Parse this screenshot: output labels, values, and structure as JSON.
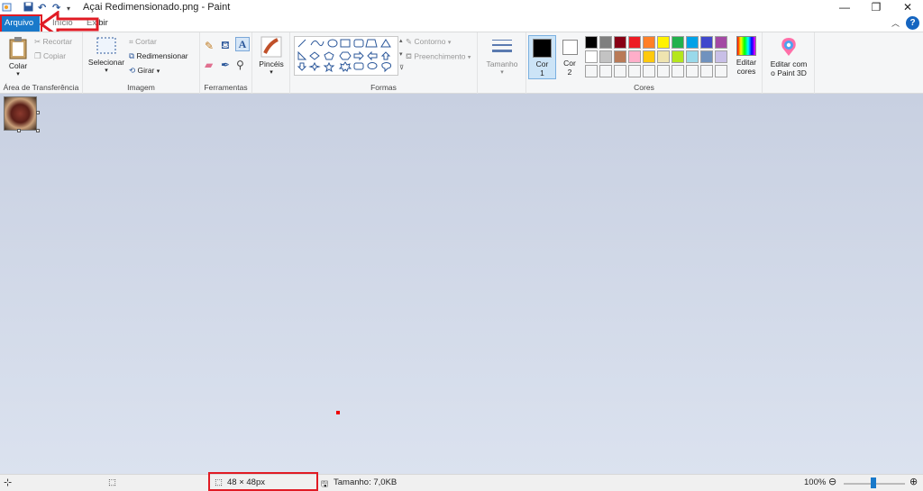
{
  "window": {
    "title": "Açai Redimensionado.png - Paint",
    "minimize": "—",
    "restore": "❐",
    "close": "✕"
  },
  "tabs": {
    "file": "Arquivo",
    "home": "Início",
    "view": "Exibir",
    "help": "?"
  },
  "clipboard": {
    "paste": "Colar",
    "cut": "Recortar",
    "copy": "Copiar",
    "label": "Área de Transferência"
  },
  "image": {
    "select": "Selecionar",
    "crop": "Cortar",
    "resize": "Redimensionar",
    "rotate": "Girar",
    "label": "Imagem"
  },
  "tools": {
    "label": "Ferramentas",
    "text_tool": "A"
  },
  "brushes": {
    "label": "Pincéis"
  },
  "shapes": {
    "outline": "Contorno",
    "fill": "Preenchimento",
    "label": "Formas"
  },
  "size": {
    "label": "Tamanho"
  },
  "colors": {
    "color1": "Cor",
    "color1_num": "1",
    "color2": "Cor",
    "color2_num": "2",
    "edit": "Editar",
    "edit2": "cores",
    "label": "Cores",
    "palette_row1": [
      "#000000",
      "#7f7f7f",
      "#880015",
      "#ed1c24",
      "#ff7f27",
      "#fff200",
      "#22b14c",
      "#00a2e8",
      "#3f48cc",
      "#a349a4"
    ],
    "palette_row2": [
      "#ffffff",
      "#c3c3c3",
      "#b97a57",
      "#ffaec9",
      "#ffc90e",
      "#efe4b0",
      "#b5e61d",
      "#99d9ea",
      "#7092be",
      "#c8bfe7"
    ]
  },
  "paint3d": {
    "line1": "Editar com",
    "line2": "o Paint 3D"
  },
  "status": {
    "dimensions": "48 × 48px",
    "filesize": "Tamanho: 7,0KB",
    "zoom": "100%"
  }
}
